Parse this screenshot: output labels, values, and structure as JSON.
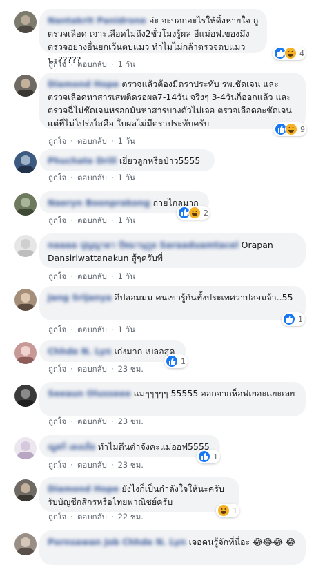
{
  "actions": {
    "like": "ถูกใจ",
    "reply": "ตอบกลับ",
    "sep": "·"
  },
  "colors": {
    "like_blue": "#1877f2",
    "haha_yellow": "#f7b125",
    "link_blue": "#385898"
  },
  "comments": [
    {
      "author": "Nantakrit Panidrone",
      "text": "อ่ะ จะบอกอะไรให้ดิ้งหายใจ กูตรวจเลือด เจาะเลือดไม่ถึง2ชั่วโมงรู้ผล อีแม่อฟ.ของมึง ตรวจอย่างอื่นยกเว้นตบแมว ทำไมไม่กล้าตรวจตบแมวน่ะ?????",
      "time": "1 วัน",
      "reactions": [
        "like-icon",
        "haha-icon"
      ],
      "reaction_count": "4"
    },
    {
      "author": "Diamond Hope",
      "text": "ตรวจแล้วต้องมีตราประทับ รพ.ชัดเจน และตรวจเลือดหาสารเสพติดรอผล7-14วัน จริงๆ 3-4วันก็ออกแล้ว และตรวจฉี่ไม่ชัดเจนหรอกมันหาสารบางตัวไม่เจอ ตรวจเลือดอะชัดเจน แต่ที่ไม่โปร่งใสคือ ใบผลไม่มีตราประทับครับ",
      "time": "1 วัน",
      "reactions": [
        "like-icon",
        "haha-icon"
      ],
      "reaction_count": "9"
    },
    {
      "author": "Phuchate Drill",
      "text": "เยี่ยวลูกหรือป่าว5555",
      "time": "1 วัน",
      "reactions": [],
      "reaction_count": ""
    },
    {
      "author": "Naeryn Boonprakong",
      "text": "ถ่ายไกลมาก",
      "time": "1 วัน",
      "reactions": [
        "like-icon",
        "haha-icon"
      ],
      "reaction_count": "2"
    },
    {
      "author": "naaaa ปุญญาดา ปัทมานุกูล Saraaduamtacel",
      "text": "Orapan Dansiriwattanakun สู้ๆครับพี่",
      "time": "1 วัน",
      "reactions": [],
      "reaction_count": ""
    },
    {
      "author": "Jang Srijanya",
      "text": "อีปลอมมม คนเขารู้กันทั้งประเทศว่าปลอมจ้า..55",
      "time": "1 วัน",
      "reactions": [
        "like-icon"
      ],
      "reaction_count": "1"
    },
    {
      "author": "Chhde N. Lyn",
      "text": "เก่งมาก เบลอสุด",
      "time": "23 ชม.",
      "reactions": [
        "like-icon"
      ],
      "reaction_count": "1"
    },
    {
      "author": "Seeaun Olusseee",
      "text": "แม่ๆๆๆๆๆ 55555 ออกจากห็อฟเยอะแยะเลย",
      "time": "23 ชม.",
      "reactions": [],
      "reaction_count": ""
    },
    {
      "author": "ณูสก์ เดงเถ้ย",
      "text": "ทำไมตีนดำจังคะแม่ออฟ5555",
      "time": "23 ชม.",
      "reactions": [
        "like-icon"
      ],
      "reaction_count": "1"
    },
    {
      "author": "Diamond Hope",
      "text": "ยังไงก็เป็นกำลังใจให้นะครับ รับบัญชีกสิกรหรือไทยพาณิชย์ครับ",
      "time": "22 ชม.",
      "reactions": [
        "haha-icon"
      ],
      "reaction_count": "1"
    },
    {
      "author": "Pornsawan Job",
      "tag": "Chhde N. Lyn",
      "text": "เจอคนรู้จักที่นี่อะ 😂😂😂 😂",
      "time": "",
      "reactions": [],
      "reaction_count": ""
    }
  ]
}
